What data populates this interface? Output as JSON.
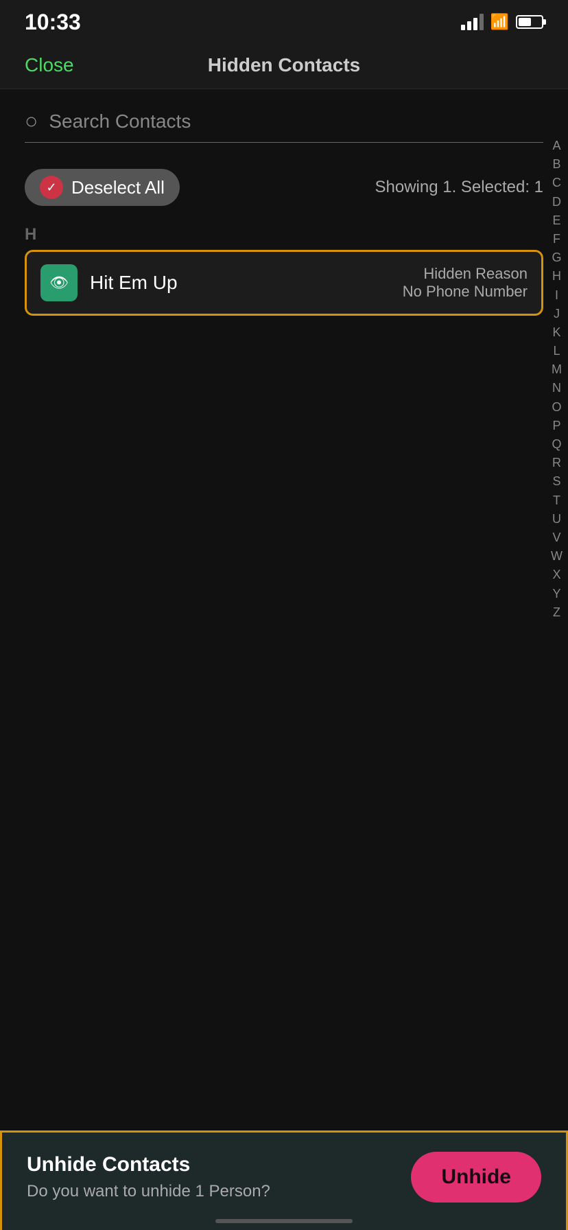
{
  "statusBar": {
    "time": "10:33"
  },
  "navBar": {
    "closeLabel": "Close",
    "title": "Hidden Contacts"
  },
  "search": {
    "placeholder": "Search Contacts"
  },
  "toolbar": {
    "deselectAllLabel": "Deselect All",
    "showingText": "Showing 1. Selected: 1"
  },
  "sectionLetter": "H",
  "contact": {
    "name": "Hit Em Up",
    "hiddenReasonLabel": "Hidden Reason",
    "hiddenReasonValue": "No Phone Number"
  },
  "alphabetIndex": [
    "A",
    "B",
    "C",
    "D",
    "E",
    "F",
    "G",
    "H",
    "I",
    "J",
    "K",
    "L",
    "M",
    "N",
    "O",
    "P",
    "Q",
    "R",
    "S",
    "T",
    "U",
    "V",
    "W",
    "X",
    "Y",
    "Z"
  ],
  "bottomSheet": {
    "title": "Unhide Contacts",
    "subtitle": "Do you want to unhide 1 Person?",
    "unhideLabel": "Unhide"
  }
}
